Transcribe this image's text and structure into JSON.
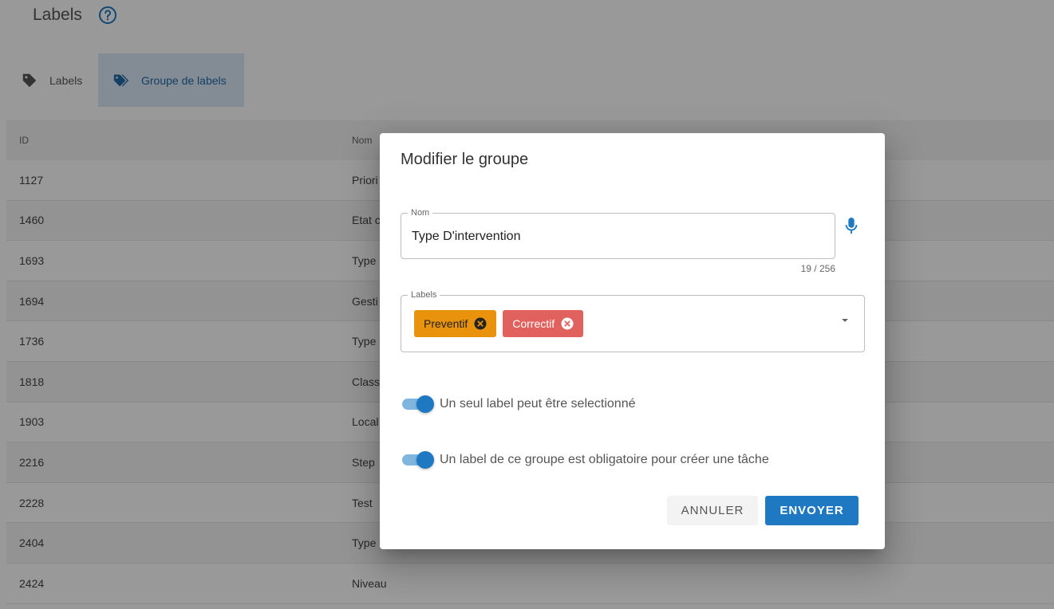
{
  "page": {
    "title": "Labels",
    "tabs": [
      {
        "label": "Labels"
      },
      {
        "label": "Groupe de labels"
      }
    ]
  },
  "table": {
    "headers": {
      "id": "ID",
      "nom": "Nom"
    },
    "rows": [
      {
        "id": "1127",
        "nom": "Priori"
      },
      {
        "id": "1460",
        "nom": "Etat c"
      },
      {
        "id": "1693",
        "nom": "Type"
      },
      {
        "id": "1694",
        "nom": "Gesti"
      },
      {
        "id": "1736",
        "nom": "Type"
      },
      {
        "id": "1818",
        "nom": "Class"
      },
      {
        "id": "1903",
        "nom": "Local"
      },
      {
        "id": "2216",
        "nom": "Step"
      },
      {
        "id": "2228",
        "nom": "Test"
      },
      {
        "id": "2404",
        "nom": "Type"
      },
      {
        "id": "2424",
        "nom": "Niveau"
      }
    ]
  },
  "dialog": {
    "title": "Modifier le groupe",
    "name_field": {
      "legend": "Nom",
      "value": "Type D'intervention",
      "counter": "19 / 256"
    },
    "labels_field": {
      "legend": "Labels",
      "chips": [
        {
          "label": "Preventif",
          "color": "#e9930d"
        },
        {
          "label": "Correctif",
          "color": "#e0615d"
        }
      ]
    },
    "toggles": [
      {
        "label": "Un seul label peut être selectionné",
        "checked": true
      },
      {
        "label": "Un label de ce groupe est obligatoire pour créer une tâche",
        "checked": true
      }
    ],
    "buttons": {
      "cancel": "ANNULER",
      "submit": "ENVOYER"
    }
  },
  "colors": {
    "primary": "#1f78c2",
    "tab_active_bg": "#dbe9f7"
  },
  "icons": [
    "help-icon",
    "tag-icon",
    "tags-icon",
    "microphone-icon",
    "close-circle-icon",
    "chevron-down-icon"
  ]
}
